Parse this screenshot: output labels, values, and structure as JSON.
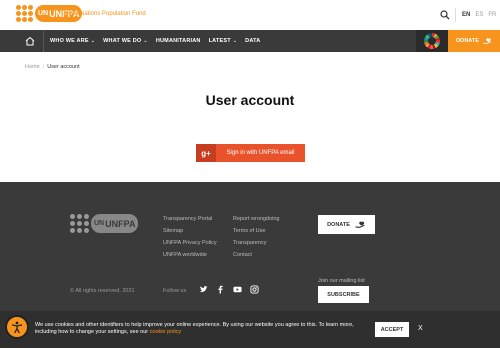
{
  "header": {
    "logo_text": "UNFPA",
    "logo_un": "UN",
    "org_name": "United Nations Population Fund",
    "search_icon": "search-icon",
    "languages": [
      "EN",
      "ES",
      "FR"
    ],
    "active_language": "EN"
  },
  "nav": {
    "home_icon": "home-icon",
    "items": [
      {
        "label": "WHO WE ARE",
        "has_dropdown": true
      },
      {
        "label": "WHAT WE DO",
        "has_dropdown": true
      },
      {
        "label": "HUMANITARIAN",
        "has_dropdown": false
      },
      {
        "label": "LATEST",
        "has_dropdown": true
      },
      {
        "label": "DATA",
        "has_dropdown": false
      }
    ],
    "donate_label": "DONATE"
  },
  "breadcrumb": {
    "home": "Home",
    "separator": "/",
    "current": "User account"
  },
  "page": {
    "title": "User account",
    "signin_icon": "g+",
    "signin_label": "Sign in with UNFPA email"
  },
  "footer": {
    "logo_text": "UNFPA",
    "logo_un": "UN",
    "col1": [
      "Transparency Portal",
      "Sitemap",
      "UNFPA Privacy Policy",
      "UNFPA worldwide"
    ],
    "col2": [
      "Report wrongdoing",
      "Terms of Use",
      "Transparency",
      "Contact"
    ],
    "donate_label": "DONATE",
    "mailing_label": "Join our mailing list",
    "subscribe_label": "SUBSCRIBE",
    "copyright": "© All rights reserved. 2021",
    "follow_label": "Follow us",
    "socials": [
      "twitter-icon",
      "facebook-icon",
      "youtube-icon",
      "instagram-icon"
    ]
  },
  "cookie": {
    "text": "We use cookies and other identifiers to help improve your online experience. By using our website you agree to this. To learn more, including how to change your settings, see our",
    "link_text": "cookie policy",
    "accept_label": "ACCEPT",
    "close_label": "X"
  },
  "colors": {
    "brand_orange": "#f7941d",
    "nav_dark": "#3a3a3a",
    "signin_red": "#e8532c"
  }
}
